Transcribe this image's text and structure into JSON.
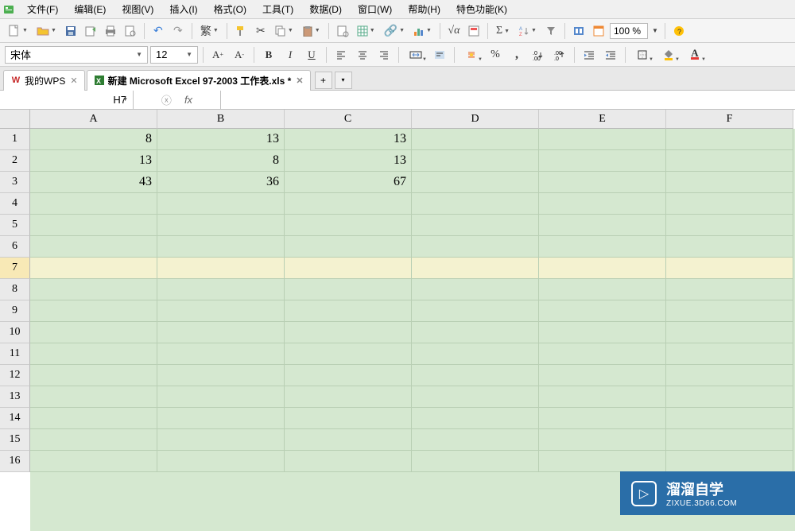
{
  "menubar": [
    {
      "label": "文件(F)"
    },
    {
      "label": "编辑(E)"
    },
    {
      "label": "视图(V)"
    },
    {
      "label": "插入(I)"
    },
    {
      "label": "格式(O)"
    },
    {
      "label": "工具(T)"
    },
    {
      "label": "数据(D)"
    },
    {
      "label": "窗口(W)"
    },
    {
      "label": "帮助(H)"
    },
    {
      "label": "特色功能(K)"
    }
  ],
  "toolbar": {
    "trad_label": "繁",
    "zoom": "100 %"
  },
  "formatbar": {
    "font_name": "宋体",
    "font_size": "12"
  },
  "tabs": [
    {
      "icon": "W",
      "icon_color": "#c62828",
      "label": "我的WPS"
    },
    {
      "icon": "X",
      "icon_color": "#2e7d32",
      "label": "新建 Microsoft Excel 97-2003 工作表.xls *",
      "active": true
    }
  ],
  "name_box": "H7",
  "columns": [
    "A",
    "B",
    "C",
    "D",
    "E",
    "F"
  ],
  "rows": [
    "1",
    "2",
    "3",
    "4",
    "5",
    "6",
    "7",
    "8",
    "9",
    "10",
    "11",
    "12",
    "13",
    "14",
    "15",
    "16"
  ],
  "selected_row": 7,
  "active_cell": {
    "row": 7,
    "col": "H"
  },
  "cells": {
    "A1": "8",
    "B1": "13",
    "C1": "13",
    "A2": "13",
    "B2": "8",
    "C2": "13",
    "A3": "43",
    "B3": "36",
    "C3": "67"
  },
  "watermark": {
    "title": "溜溜自学",
    "url": "ZIXUE.3D66.COM"
  }
}
